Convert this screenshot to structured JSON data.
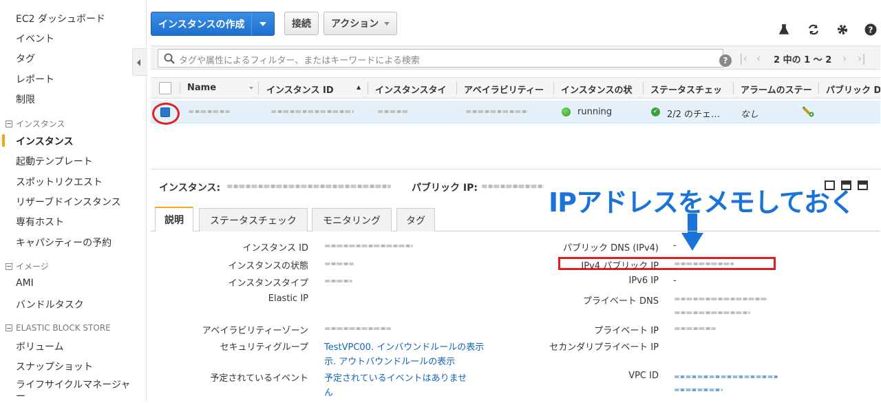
{
  "sidebar": {
    "top_items": [
      "EC2 ダッシュボード",
      "イベント",
      "タグ",
      "レポート",
      "制限"
    ],
    "sections": [
      {
        "title": "インスタンス",
        "items": [
          "インスタンス",
          "起動テンプレート",
          "スポットリクエスト",
          "リザーブドインスタンス",
          "専有ホスト",
          "キャパシティーの予約"
        ]
      },
      {
        "title": "イメージ",
        "items": [
          "AMI",
          "バンドルタスク"
        ]
      },
      {
        "title": "ELASTIC BLOCK STORE",
        "items": [
          "ボリューム",
          "スナップショット",
          "ライフサイクルマネージャー"
        ]
      }
    ],
    "active_item": "インスタンス"
  },
  "toolbar": {
    "launch_label": "インスタンスの作成",
    "connect_label": "接続",
    "actions_label": "アクション"
  },
  "search": {
    "placeholder": "タグや属性によるフィルター、またはキーワードによる検索",
    "help": "?",
    "pager_text": "2 中の 1 〜 2"
  },
  "table": {
    "headers": [
      "Name",
      "インスタンス ID",
      "インスタンスタイ",
      "アベイラビリティー",
      "インスタンスの状",
      "ステータスチェッ",
      "アラームのステー",
      "パブリック D"
    ],
    "row": {
      "state": "running",
      "status_check": "2/2 のチェ…",
      "alarm": "なし"
    }
  },
  "details": {
    "title_label": "インスタンス:",
    "public_ip_label": "パブリック IP:",
    "annotation": "IPアドレスをメモしておく",
    "tabs": [
      "説明",
      "ステータスチェック",
      "モニタリング",
      "タグ"
    ],
    "left": [
      {
        "label": "インスタンス ID"
      },
      {
        "label": "インスタンスの状態"
      },
      {
        "label": "インスタンスタイプ"
      },
      {
        "label": "Elastic IP"
      },
      {
        "label": "アベイラビリティーゾーン"
      },
      {
        "label": "セキュリティグループ",
        "value1": "TestVPC00. インバウンドルールの表示",
        "value2": "示. アウトバウンドルールの表示"
      },
      {
        "label": "予定されているイベント",
        "value1": "予定されているイベントはありませ",
        "value2": "ん"
      }
    ],
    "right": [
      {
        "label": "パブリック DNS (IPv4)",
        "value": "-"
      },
      {
        "label": "IPv4 パブリック IP"
      },
      {
        "label": "IPv6 IP",
        "value": "-"
      },
      {
        "label": "プライベート DNS"
      },
      {
        "label": "プライベート IP"
      },
      {
        "label": "セカンダリプライベート IP"
      },
      {
        "label": "VPC ID"
      }
    ]
  },
  "colors": {
    "accent": "#1a73d8",
    "highlight": "#e02020",
    "tab_accent": "#f7a41d"
  }
}
